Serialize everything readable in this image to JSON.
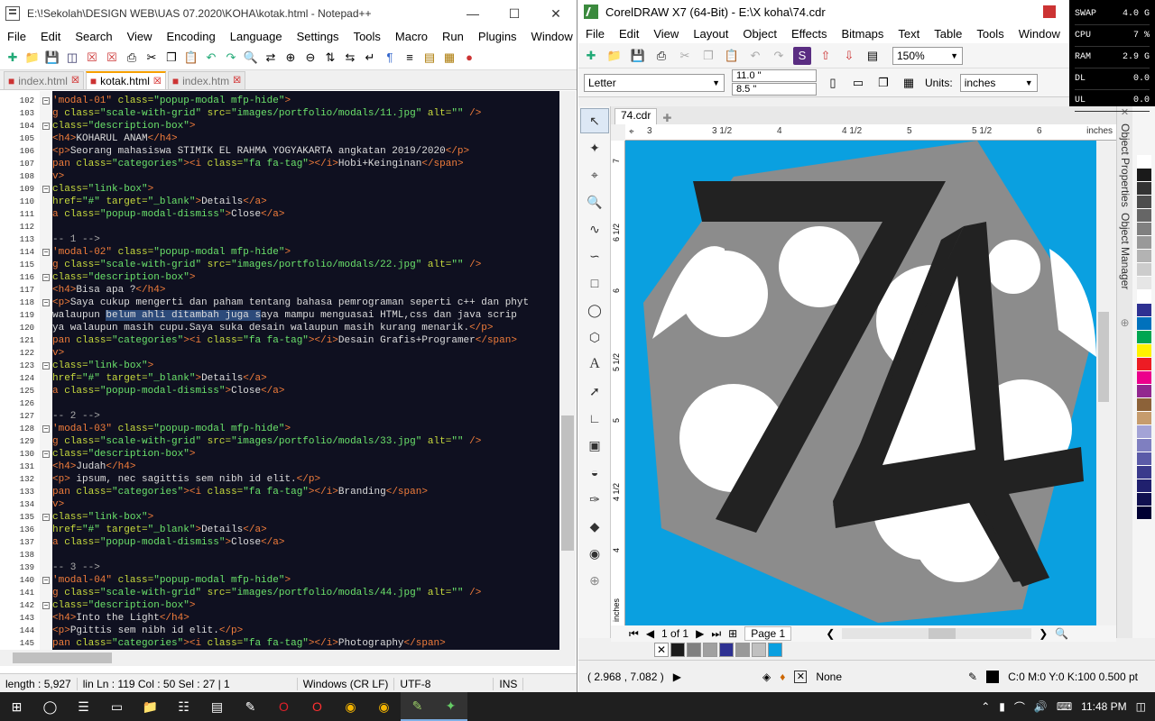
{
  "npp": {
    "title": "E:\\!Sekolah\\DESIGN WEB\\UAS 07.2020\\KOHA\\kotak.html - Notepad++",
    "menu": [
      "File",
      "Edit",
      "Search",
      "View",
      "Encoding",
      "Language",
      "Settings",
      "Tools",
      "Macro",
      "Run",
      "Plugins",
      "Window",
      "?"
    ],
    "menu_close": "X",
    "tabs": [
      {
        "label": "index.html",
        "active": false
      },
      {
        "label": "kotak.html",
        "active": true
      },
      {
        "label": "index.htm",
        "active": false
      }
    ],
    "lines": [
      {
        "n": "102",
        "h": "<span class=\"t\">'modal-01\"</span> <span class=\"a\">class=</span><span class=\"v\">\"popup-modal mfp-hide\"</span><span class=\"t\">&gt;</span>"
      },
      {
        "n": "103",
        "h": "<span class=\"t\">g</span> <span class=\"a\">class=</span><span class=\"v\">\"scale-with-grid\"</span> <span class=\"a\">src=</span><span class=\"v\">\"images/portfolio/modals/11.jpg\"</span> <span class=\"a\">alt=</span><span class=\"v\">\"\"</span> <span class=\"t\">/&gt;</span>"
      },
      {
        "n": "104",
        "h": "<span class=\"a\">class=</span><span class=\"v\">\"description-box\"</span><span class=\"t\">&gt;</span>"
      },
      {
        "n": "105",
        "h": "<span class=\"t\">&lt;h4&gt;</span>KOHARUL ANAM<span class=\"t\">&lt;/h4&gt;</span>"
      },
      {
        "n": "106",
        "h": "<span class=\"t\">&lt;p&gt;</span>Seorang mahasiswa STIMIK EL RAHMA YOGYAKARTA angkatan 2019/2020<span class=\"t\">&lt;/p&gt;</span>"
      },
      {
        "n": "107",
        "h": "<span class=\"t\">pan</span> <span class=\"a\">class=</span><span class=\"v\">\"categories\"</span><span class=\"t\">&gt;&lt;i</span> <span class=\"a\">class=</span><span class=\"v\">\"fa fa-tag\"</span><span class=\"t\">&gt;&lt;/i&gt;</span>Hobi+Keinginan<span class=\"t\">&lt;/span&gt;</span>"
      },
      {
        "n": "108",
        "h": "<span class=\"t\">v&gt;</span>"
      },
      {
        "n": "109",
        "h": "<span class=\"a\">class=</span><span class=\"v\">\"link-box\"</span><span class=\"t\">&gt;</span>"
      },
      {
        "n": "110",
        "h": "<span class=\"a\">href=</span><span class=\"v\">\"#\"</span> <span class=\"a\">target=</span><span class=\"v\">\"_blank\"</span><span class=\"t\">&gt;</span>Details<span class=\"t\">&lt;/a&gt;</span>"
      },
      {
        "n": "111",
        "h": "<span class=\"t\">a</span> <span class=\"a\">class=</span><span class=\"v\">\"popup-modal-dismiss\"</span><span class=\"t\">&gt;</span>Close<span class=\"t\">&lt;/a&gt;</span>"
      },
      {
        "n": "112",
        "h": ""
      },
      {
        "n": "113",
        "h": "<span class=\"c\">-- 1 --&gt;</span>"
      },
      {
        "n": "114",
        "h": "<span class=\"t\">'modal-02\"</span> <span class=\"a\">class=</span><span class=\"v\">\"popup-modal mfp-hide\"</span><span class=\"t\">&gt;</span>"
      },
      {
        "n": "115",
        "h": "<span class=\"t\">g</span> <span class=\"a\">class=</span><span class=\"v\">\"scale-with-grid\"</span> <span class=\"a\">src=</span><span class=\"v\">\"images/portfolio/modals/22.jpg\"</span> <span class=\"a\">alt=</span><span class=\"v\">\"\"</span> <span class=\"t\">/&gt;</span>"
      },
      {
        "n": "116",
        "h": "<span class=\"a\">class=</span><span class=\"v\">\"description-box\"</span><span class=\"t\">&gt;</span>"
      },
      {
        "n": "117",
        "h": "<span class=\"t\">&lt;h4&gt;</span>Bisa apa ?<span class=\"t\">&lt;/h4&gt;</span>"
      },
      {
        "n": "118",
        "h": "<span class=\"t\">&lt;p&gt;</span>Saya cukup mengerti dan paham tentang bahasa pemrograman seperti c++ dan phyt"
      },
      {
        "n": "119",
        "h": "walaupun <span class=\"sel\">belum ahli ditambah juga s</span>aya mampu menguasai HTML,css dan java scrip"
      },
      {
        "n": "120",
        "h": "ya walaupun masih cupu.Saya suka desain walaupun masih kurang menarik.<span class=\"t\">&lt;/p&gt;</span>"
      },
      {
        "n": "121",
        "h": "<span class=\"t\">pan</span> <span class=\"a\">class=</span><span class=\"v\">\"categories\"</span><span class=\"t\">&gt;&lt;i</span> <span class=\"a\">class=</span><span class=\"v\">\"fa fa-tag\"</span><span class=\"t\">&gt;&lt;/i&gt;</span>Desain Grafis+Programer<span class=\"t\">&lt;/span&gt;</span>"
      },
      {
        "n": "122",
        "h": "<span class=\"t\">v&gt;</span>"
      },
      {
        "n": "123",
        "h": "<span class=\"a\">class=</span><span class=\"v\">\"link-box\"</span><span class=\"t\">&gt;</span>"
      },
      {
        "n": "124",
        "h": "<span class=\"a\">href=</span><span class=\"v\">\"#\"</span> <span class=\"a\">target=</span><span class=\"v\">\"_blank\"</span><span class=\"t\">&gt;</span>Details<span class=\"t\">&lt;/a&gt;</span>"
      },
      {
        "n": "125",
        "h": "<span class=\"t\">a</span> <span class=\"a\">class=</span><span class=\"v\">\"popup-modal-dismiss\"</span><span class=\"t\">&gt;</span>Close<span class=\"t\">&lt;/a&gt;</span>"
      },
      {
        "n": "126",
        "h": ""
      },
      {
        "n": "127",
        "h": "<span class=\"c\">-- 2 --&gt;</span>"
      },
      {
        "n": "128",
        "h": "<span class=\"t\">'modal-03\"</span> <span class=\"a\">class=</span><span class=\"v\">\"popup-modal mfp-hide\"</span><span class=\"t\">&gt;</span>"
      },
      {
        "n": "129",
        "h": "<span class=\"t\">g</span> <span class=\"a\">class=</span><span class=\"v\">\"scale-with-grid\"</span> <span class=\"a\">src=</span><span class=\"v\">\"images/portfolio/modals/33.jpg\"</span> <span class=\"a\">alt=</span><span class=\"v\">\"\"</span> <span class=\"t\">/&gt;</span>"
      },
      {
        "n": "130",
        "h": "<span class=\"a\">class=</span><span class=\"v\">\"description-box\"</span><span class=\"t\">&gt;</span>"
      },
      {
        "n": "131",
        "h": "<span class=\"t\">&lt;h4&gt;</span>Judah<span class=\"t\">&lt;/h4&gt;</span>"
      },
      {
        "n": "132",
        "h": "<span class=\"t\">&lt;p&gt;</span> ipsum, nec sagittis sem nibh id elit.<span class=\"t\">&lt;/p&gt;</span>"
      },
      {
        "n": "133",
        "h": "<span class=\"t\">pan</span> <span class=\"a\">class=</span><span class=\"v\">\"categories\"</span><span class=\"t\">&gt;&lt;i</span> <span class=\"a\">class=</span><span class=\"v\">\"fa fa-tag\"</span><span class=\"t\">&gt;&lt;/i&gt;</span>Branding<span class=\"t\">&lt;/span&gt;</span>"
      },
      {
        "n": "134",
        "h": "<span class=\"t\">v&gt;</span>"
      },
      {
        "n": "135",
        "h": "<span class=\"a\">class=</span><span class=\"v\">\"link-box\"</span><span class=\"t\">&gt;</span>"
      },
      {
        "n": "136",
        "h": "<span class=\"a\">href=</span><span class=\"v\">\"#\"</span> <span class=\"a\">target=</span><span class=\"v\">\"_blank\"</span><span class=\"t\">&gt;</span>Details<span class=\"t\">&lt;/a&gt;</span>"
      },
      {
        "n": "137",
        "h": "<span class=\"t\">a</span> <span class=\"a\">class=</span><span class=\"v\">\"popup-modal-dismiss\"</span><span class=\"t\">&gt;</span>Close<span class=\"t\">&lt;/a&gt;</span>"
      },
      {
        "n": "138",
        "h": ""
      },
      {
        "n": "139",
        "h": "<span class=\"c\">-- 3 --&gt;</span>"
      },
      {
        "n": "140",
        "h": "<span class=\"t\">'modal-04\"</span> <span class=\"a\">class=</span><span class=\"v\">\"popup-modal mfp-hide\"</span><span class=\"t\">&gt;</span>"
      },
      {
        "n": "141",
        "h": "<span class=\"t\">g</span> <span class=\"a\">class=</span><span class=\"v\">\"scale-with-grid\"</span> <span class=\"a\">src=</span><span class=\"v\">\"images/portfolio/modals/44.jpg\"</span> <span class=\"a\">alt=</span><span class=\"v\">\"\"</span> <span class=\"t\">/&gt;</span>"
      },
      {
        "n": "142",
        "h": "<span class=\"a\">class=</span><span class=\"v\">\"description-box\"</span><span class=\"t\">&gt;</span>"
      },
      {
        "n": "143",
        "h": "<span class=\"t\">&lt;h4&gt;</span>Into the Light<span class=\"t\">&lt;/h4&gt;</span>"
      },
      {
        "n": "144",
        "h": "<span class=\"t\">&lt;p&gt;</span>Pgittis sem nibh id elit.<span class=\"t\">&lt;/p&gt;</span>"
      },
      {
        "n": "145",
        "h": "<span class=\"t\">pan</span> <span class=\"a\">class=</span><span class=\"v\">\"categories\"</span><span class=\"t\">&gt;&lt;i</span> <span class=\"a\">class=</span><span class=\"v\">\"fa fa-tag\"</span><span class=\"t\">&gt;&lt;/i&gt;</span>Photography<span class=\"t\">&lt;/span&gt;</span>"
      }
    ],
    "status": {
      "length": "length : 5,927",
      "pos": "lin  Ln : 119    Col : 50    Sel : 27 | 1",
      "eol": "Windows (CR LF)",
      "enc": "UTF-8",
      "mode": "INS"
    }
  },
  "cdr": {
    "title": "CorelDRAW X7 (64-Bit) - E:\\X koha\\74.cdr",
    "menu": [
      "File",
      "Edit",
      "View",
      "Layout",
      "Object",
      "Effects",
      "Bitmaps",
      "Text",
      "Table",
      "Tools",
      "Window"
    ],
    "zoom": "150%",
    "page_size": "Letter",
    "width": "11.0 \"",
    "height": "8.5 \"",
    "units_label": "Units:",
    "units": "inches",
    "doc_tab": "74.cdr",
    "ruler_ticks": [
      "3",
      "3 1/2",
      "4",
      "4 1/2",
      "5",
      "5 1/2",
      "6"
    ],
    "ruler_unit": "inches",
    "vruler_ticks": [
      "7",
      "6 1/2",
      "6",
      "5 1/2",
      "5",
      "4 1/2",
      "4"
    ],
    "vruler_unit": "inches",
    "page_counter": "1 of 1",
    "page_tab": "Page 1",
    "coords": "( 2.968 , 7.082 )",
    "fill_label": "None",
    "outline": "C:0 M:0 Y:0 K:100  0.500 pt",
    "dockers": [
      "Object Properties",
      "Object Manager"
    ],
    "palette": [
      "#ffffff",
      "#1a1a1a",
      "#333333",
      "#4d4d4d",
      "#666666",
      "#808080",
      "#999999",
      "#b3b3b3",
      "#cccccc",
      "#e6e6e6",
      "#ffffff",
      "#2e3192",
      "#0071bc",
      "#00a651",
      "#fff200",
      "#ed1c24",
      "#ec008c",
      "#92278f",
      "#8c6239",
      "#c69c6d",
      "#a3a3d6",
      "#7f7fc0",
      "#5b5ba8",
      "#3a3a8c",
      "#20206e",
      "#101050",
      "#000033"
    ],
    "doc_palette": [
      "#1a1a1a",
      "#808080",
      "#a0a0a0",
      "#2e3192",
      "#999999",
      "#c0c0c0",
      "#0aa0e0"
    ],
    "colors": {
      "canvas": "#0aa0e0",
      "hexagon": "#8c8c8c",
      "numeral": "#222222",
      "shapes": "#ffffff"
    }
  },
  "sysmon": [
    {
      "k": "SWAP",
      "v": "4.0 G"
    },
    {
      "k": "CPU",
      "v": "7 %"
    },
    {
      "k": "RAM",
      "v": "2.9 G"
    },
    {
      "k": "DL",
      "v": "0.0"
    },
    {
      "k": "UL",
      "v": "0.0"
    }
  ],
  "taskbar": {
    "apps": [
      "start-icon",
      "search-icon",
      "task-view-icon",
      "terminal-icon",
      "file-explorer-icon",
      "network-icon",
      "media-icon",
      "notepad-icon",
      "opera-icon",
      "opera-red-icon",
      "chrome-icon",
      "chrome-icon-2",
      "notepadpp-icon",
      "coreldraw-icon"
    ],
    "time": "11:48 PM"
  }
}
